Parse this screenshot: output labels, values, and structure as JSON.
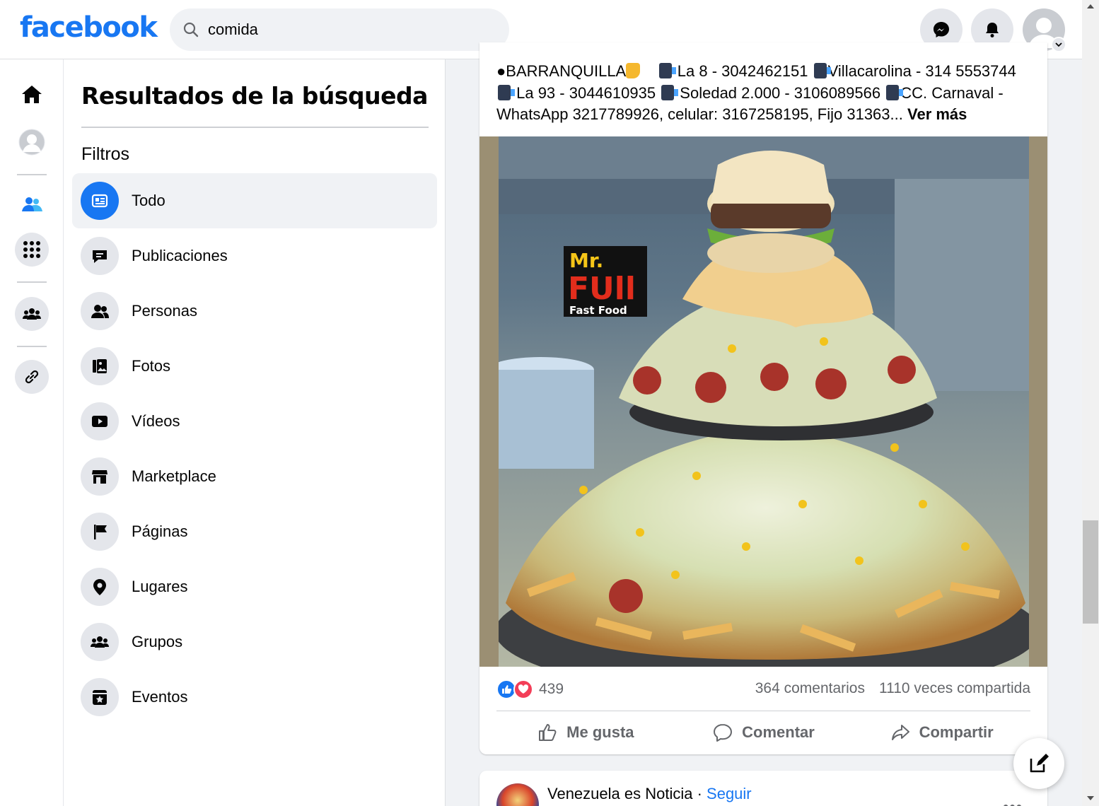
{
  "brand": {
    "logo_text": "facebook",
    "color": "#1877f2"
  },
  "search": {
    "value": "comida",
    "icon": "search-icon"
  },
  "topbar": {
    "messenger_icon": "messenger-icon",
    "notifications_icon": "bell-icon",
    "account_icon": "avatar"
  },
  "rail": {
    "items": [
      {
        "name": "home",
        "icon": "home-icon"
      },
      {
        "name": "profile",
        "icon": "avatar"
      },
      {
        "name": "friends",
        "icon": "friends-icon"
      },
      {
        "name": "menu",
        "icon": "apps-grid-icon"
      },
      {
        "name": "groups",
        "icon": "groups-icon"
      },
      {
        "name": "links",
        "icon": "link-icon"
      }
    ]
  },
  "sidebar": {
    "title": "Resultados de la búsqueda",
    "filters_heading": "Filtros",
    "filters": [
      {
        "label": "Todo",
        "icon": "feed-icon",
        "active": true
      },
      {
        "label": "Publicaciones",
        "icon": "post-icon"
      },
      {
        "label": "Personas",
        "icon": "people-icon"
      },
      {
        "label": "Fotos",
        "icon": "photos-icon"
      },
      {
        "label": "Vídeos",
        "icon": "video-icon"
      },
      {
        "label": "Marketplace",
        "icon": "store-icon"
      },
      {
        "label": "Páginas",
        "icon": "flag-icon"
      },
      {
        "label": "Lugares",
        "icon": "pin-icon"
      },
      {
        "label": "Grupos",
        "icon": "groups-icon"
      },
      {
        "label": "Eventos",
        "icon": "calendar-star-icon"
      }
    ]
  },
  "post": {
    "text": {
      "line1_a": "●BARRANQUILLA",
      "line1_b": " La 8 - 3042462151 ",
      "line1_c": "Villacarolina - 314 5553744",
      "line2_a": " La 93 -  3044610935 ",
      "line2_b": " Soledad 2.000 - 3106089566 ",
      "line2_c": "CC. Carnaval -",
      "line3": "WhatsApp 3217789926, celular: 3167258195, Fijo 31363...",
      "see_more": "Ver más"
    },
    "image_alt": "Mr. Full Fast Food",
    "image_logo_top": "Mr.",
    "image_logo_mid": "FUll",
    "image_logo_sub": "Fast Food",
    "reactions": {
      "count": "439",
      "types": [
        "like",
        "love"
      ]
    },
    "comments": "364 comentarios",
    "shares": "1110 veces compartida",
    "actions": {
      "like": "Me gusta",
      "comment": "Comentar",
      "share": "Compartir"
    }
  },
  "next_post": {
    "page_name": "Venezuela es Noticia",
    "separator": " · ",
    "follow": "Seguir",
    "more": "•••"
  },
  "colors": {
    "accent": "#1877f2",
    "love": "#f33e58",
    "muted": "#65676b"
  }
}
